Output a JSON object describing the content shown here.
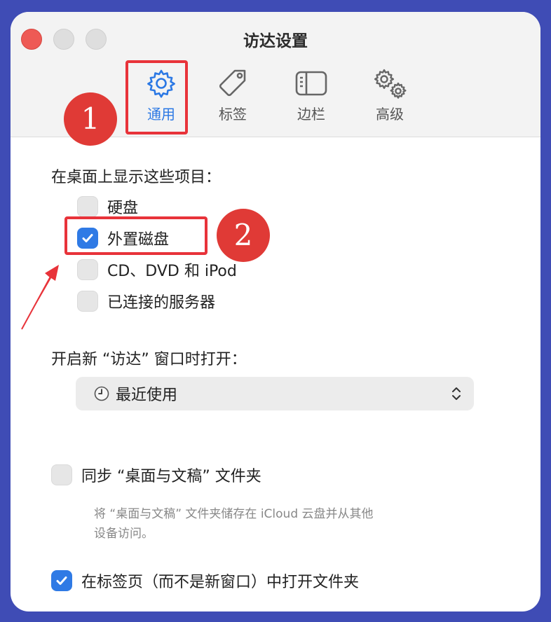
{
  "window": {
    "title": "访达设置"
  },
  "toolbar": {
    "tabs": [
      {
        "label": "通用",
        "icon": "gear-icon",
        "selected": true
      },
      {
        "label": "标签",
        "icon": "tag-icon",
        "selected": false
      },
      {
        "label": "边栏",
        "icon": "sidebar-icon",
        "selected": false
      },
      {
        "label": "高级",
        "icon": "gears-icon",
        "selected": false
      }
    ]
  },
  "annotations": {
    "badge1": "1",
    "badge2": "2",
    "color": "#e03a36"
  },
  "desktop": {
    "heading": "在桌面上显示这些项目：",
    "items": [
      {
        "label": "硬盘",
        "checked": false
      },
      {
        "label": "外置磁盘",
        "checked": true
      },
      {
        "label": "CD、DVD 和 iPod",
        "checked": false
      },
      {
        "label": "已连接的服务器",
        "checked": false
      }
    ]
  },
  "new_window": {
    "heading": "开启新 “访达” 窗口时打开：",
    "selected_value": "最近使用",
    "icon": "clock-icon"
  },
  "sync": {
    "label": "同步 “桌面与文稿” 文件夹",
    "checked": false,
    "description": "将 “桌面与文稿” 文件夹储存在 iCloud 云盘并从其他设备访问。",
    "description_line1": "将 “桌面与文稿” 文件夹储存在 iCloud 云盘并从其他",
    "description_line2": "设备访问。"
  },
  "tabs_option": {
    "label": "在标签页（而不是新窗口）中打开文件夹",
    "checked": true
  },
  "colors": {
    "accent": "#2f7ae5",
    "background": "#3f4cb5"
  }
}
